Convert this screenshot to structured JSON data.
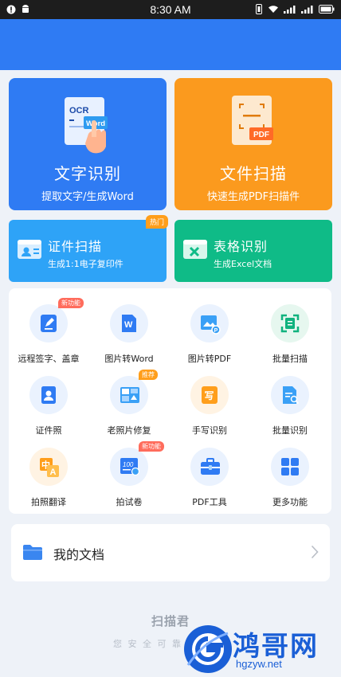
{
  "status_bar": {
    "time": "8:30 AM"
  },
  "cards": {
    "ocr": {
      "title": "文字识别",
      "subtitle": "提取文字/生成Word",
      "art_text_top": "OCR",
      "art_text_tag": "Word"
    },
    "scan": {
      "title": "文件扫描",
      "subtitle": "快速生成PDF扫描件",
      "art_text_tag": "PDF"
    },
    "id_scan": {
      "title": "证件扫描",
      "subtitle": "生成1:1电子复印件",
      "badge": "热门"
    },
    "table": {
      "title": "表格识别",
      "subtitle": "生成Excel文档"
    }
  },
  "tools": [
    {
      "label": "远程签字、盖章",
      "badge": "新功能",
      "icon": "pen-icon"
    },
    {
      "label": "图片转Word",
      "badge": "",
      "icon": "word-icon"
    },
    {
      "label": "图片转PDF",
      "badge": "",
      "icon": "image-pdf-icon"
    },
    {
      "label": "批量扫描",
      "badge": "",
      "icon": "scan-frame-icon"
    },
    {
      "label": "证件照",
      "badge": "",
      "icon": "id-photo-icon"
    },
    {
      "label": "老照片修复",
      "badge": "推荐",
      "icon": "photo-icon"
    },
    {
      "label": "手写识别",
      "badge": "",
      "icon": "handwriting-icon"
    },
    {
      "label": "批量识别",
      "badge": "",
      "icon": "doc-search-icon"
    },
    {
      "label": "拍照翻译",
      "badge": "",
      "icon": "translate-icon"
    },
    {
      "label": "拍试卷",
      "badge": "新功能",
      "icon": "exam-paper-icon"
    },
    {
      "label": "PDF工具",
      "badge": "",
      "icon": "toolbox-icon"
    },
    {
      "label": "更多功能",
      "badge": "",
      "icon": "grid-icon"
    }
  ],
  "docs": {
    "label": "我的文档"
  },
  "footer": {
    "title": "扫描君",
    "subtitle": "您 安 全 可 靠 的"
  },
  "watermark": {
    "text": "鸿哥网",
    "url": "hgzyw.net"
  },
  "colors": {
    "primary": "#2f7bf3",
    "orange": "#fb9a1e",
    "light_blue": "#2ea3f7",
    "green": "#0fbb87"
  }
}
